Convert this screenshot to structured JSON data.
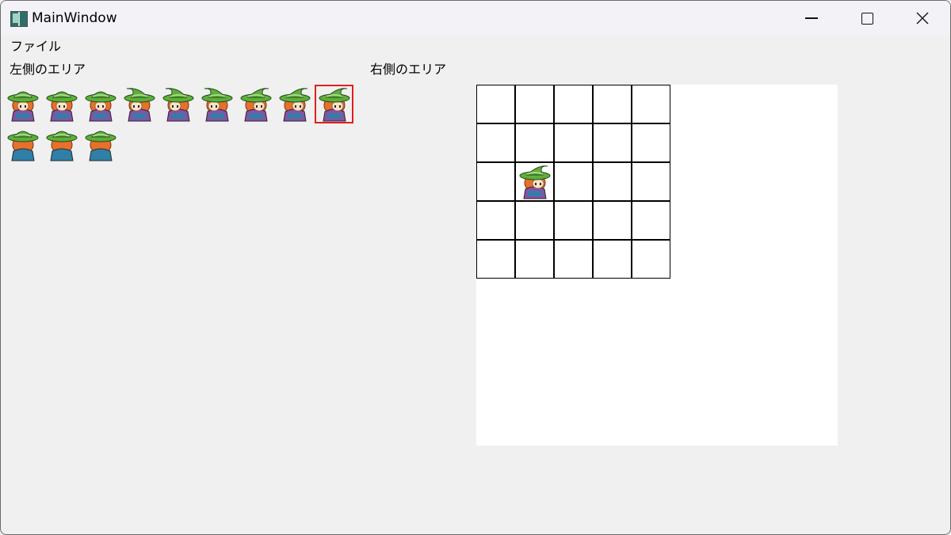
{
  "window": {
    "title": "MainWindow",
    "controls": {
      "minimize": "minimize",
      "maximize": "maximize",
      "close": "close"
    }
  },
  "menu": {
    "file": "ファイル"
  },
  "left_area": {
    "label": "左側のエリア",
    "sprites": [
      {
        "facing": "front",
        "pose": 1
      },
      {
        "facing": "front",
        "pose": 2
      },
      {
        "facing": "front",
        "pose": 3
      },
      {
        "facing": "left",
        "pose": 1
      },
      {
        "facing": "left",
        "pose": 2
      },
      {
        "facing": "left",
        "pose": 3
      },
      {
        "facing": "right",
        "pose": 1
      },
      {
        "facing": "right",
        "pose": 2
      },
      {
        "facing": "right",
        "pose": 3,
        "selected": true
      },
      {
        "facing": "back",
        "pose": 1
      },
      {
        "facing": "back",
        "pose": 2
      },
      {
        "facing": "back",
        "pose": 3
      }
    ],
    "selected_index": 8
  },
  "right_area": {
    "label": "右側のエリア",
    "grid": {
      "rows": 5,
      "cols": 5
    },
    "placed": [
      {
        "row": 2,
        "col": 1,
        "sprite_index": 8
      }
    ]
  },
  "colors": {
    "selection": "#e0201e",
    "hat": "#5fae3a",
    "hair": "#e8702a",
    "robe": "#2f7fa6",
    "skirt": "#8a4fa8"
  }
}
